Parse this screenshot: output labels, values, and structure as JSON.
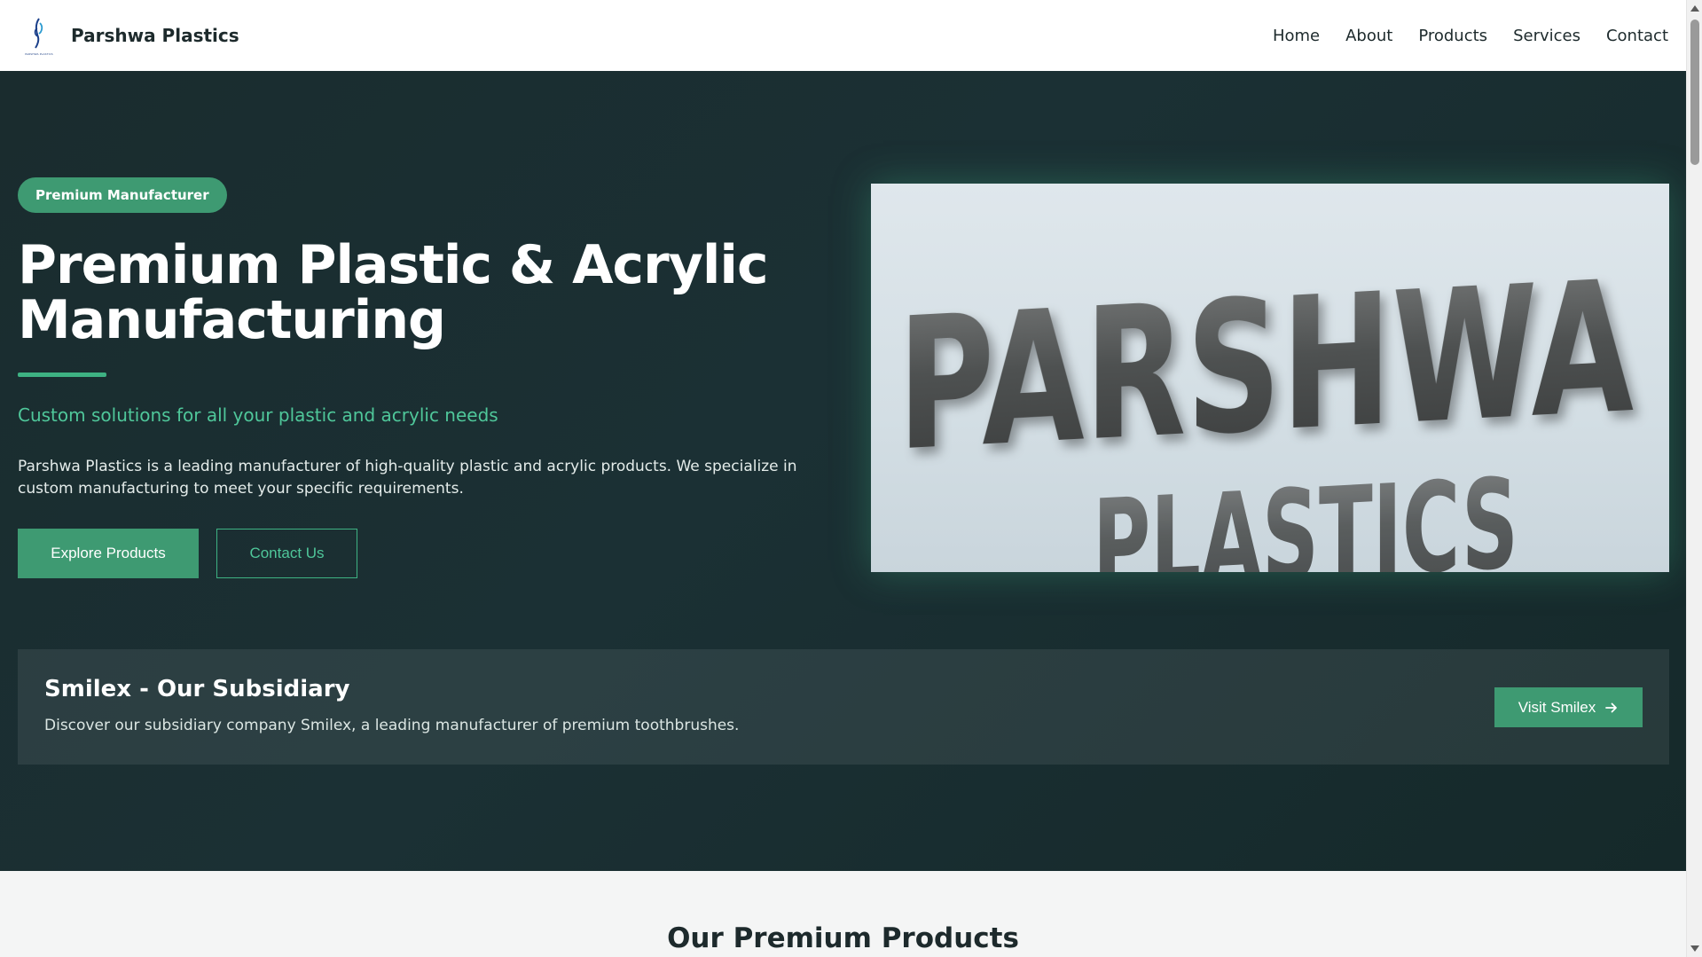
{
  "header": {
    "logo_text": "PARSHWA PLASTICS",
    "brand_name": "Parshwa Plastics",
    "nav": [
      "Home",
      "About",
      "Products",
      "Services",
      "Contact"
    ]
  },
  "hero": {
    "badge": "Premium Manufacturer",
    "title": "Premium Plastic & Acrylic Manufacturing",
    "subtitle": "Custom solutions for all your plastic and acrylic needs",
    "description": "Parshwa Plastics is a leading manufacturer of high-quality plastic and acrylic products. We specialize in custom manufacturing to meet your specific requirements.",
    "primary_button": "Explore Products",
    "secondary_button": "Contact Us",
    "image": {
      "line1": "PARSHWA",
      "line2": "PLASTICS"
    }
  },
  "subsidiary": {
    "title": "Smilex - Our Subsidiary",
    "description": "Discover our subsidiary company Smilex, a leading manufacturer of premium toothbrushes.",
    "button": "Visit Smilex",
    "button_icon": "arrow-right-icon"
  },
  "products": {
    "title": "Our Premium Products"
  },
  "colors": {
    "accent": "#3e9a72",
    "accent_light": "#4fc79a",
    "hero_bg": "#1b3034",
    "dark_text": "#1d2a2c"
  }
}
